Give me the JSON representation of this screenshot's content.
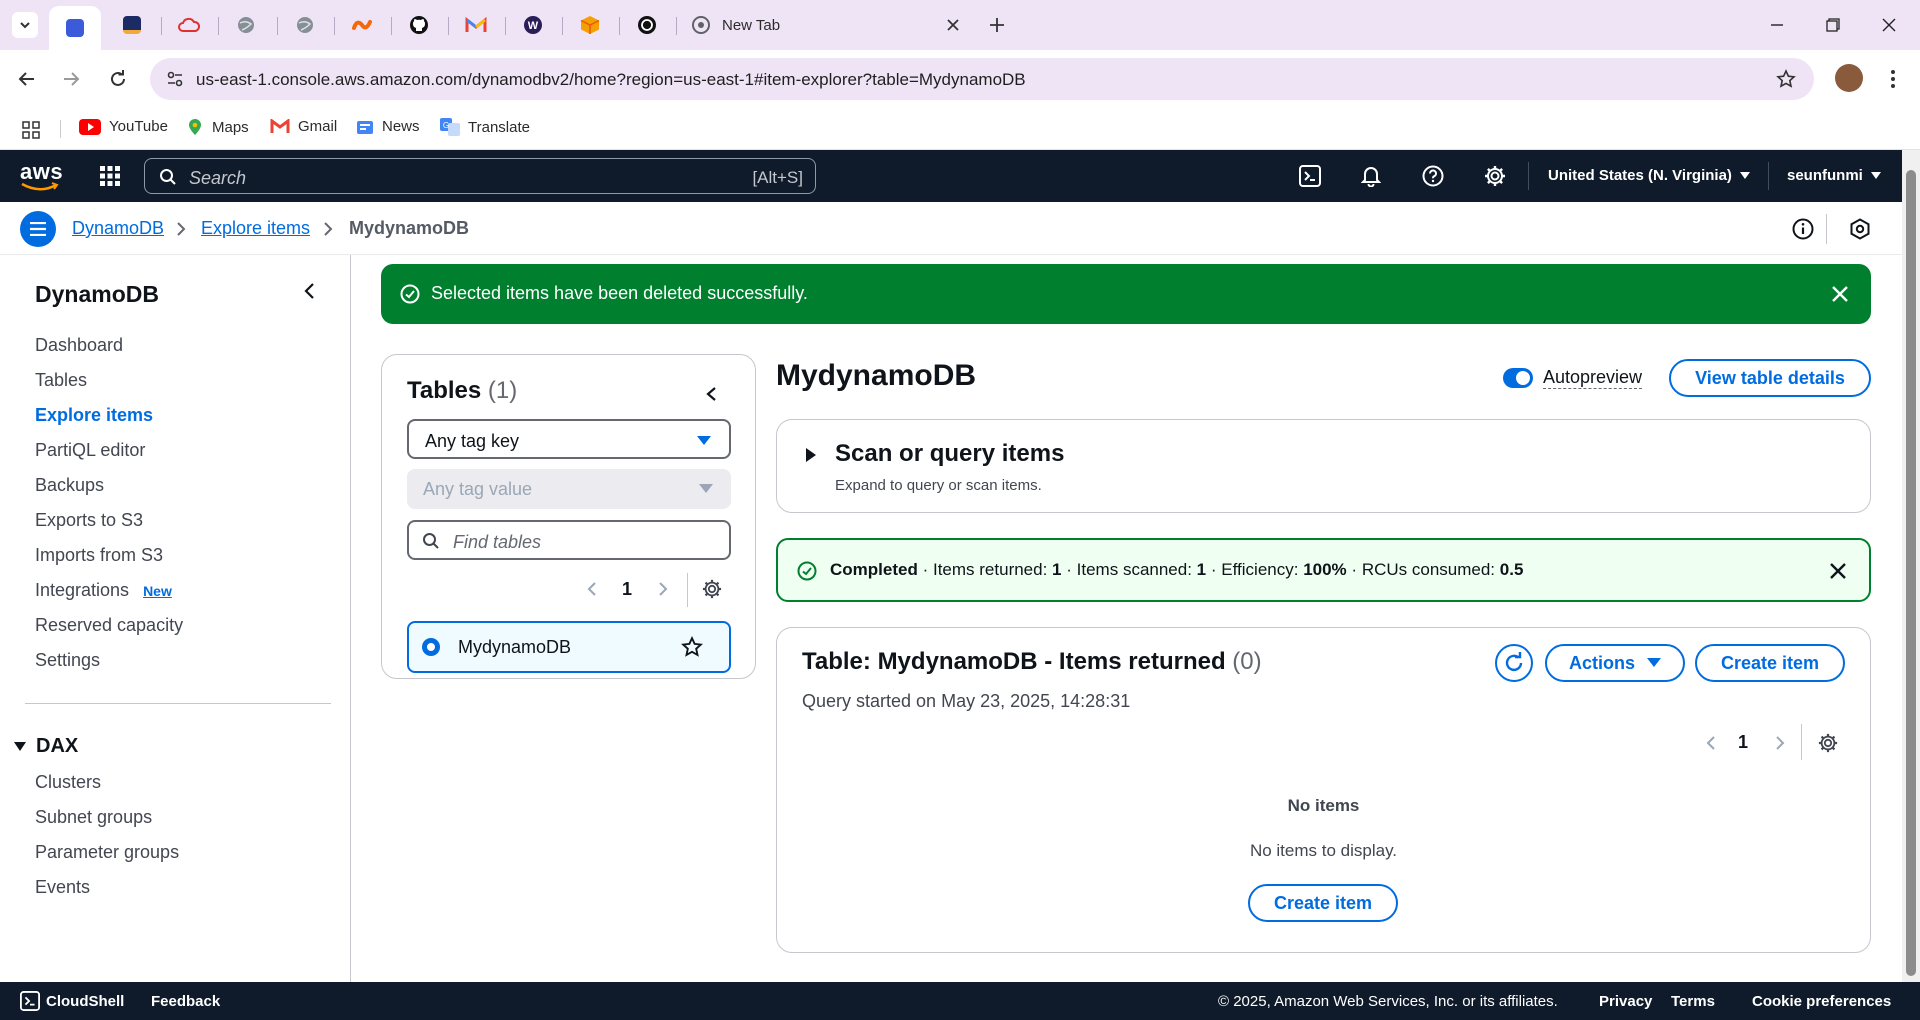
{
  "browser": {
    "tabs": [
      {
        "name": "pinned-tab-1",
        "color": "#3b5bdb"
      },
      {
        "name": "pinned-tab-2",
        "color": "#1d2b64"
      },
      {
        "name": "pinned-tab-3",
        "color": "#e03131"
      },
      {
        "name": "pinned-tab-4",
        "color": "#868e96"
      },
      {
        "name": "pinned-tab-5",
        "color": "#868e96"
      },
      {
        "name": "pinned-tab-6",
        "color": "#f76707"
      },
      {
        "name": "pinned-tab-7",
        "color": "#111111"
      },
      {
        "name": "pinned-tab-8",
        "color": "#ea4335"
      },
      {
        "name": "pinned-tab-9",
        "color": "#2b1d58"
      },
      {
        "name": "pinned-tab-10",
        "color": "#f59f00"
      },
      {
        "name": "pinned-tab-11",
        "color": "#111111"
      }
    ],
    "new_tab_title": "New Tab",
    "url": "us-east-1.console.aws.amazon.com/dynamodbv2/home?region=us-east-1#item-explorer?table=MydynamoDB",
    "bookmarks": [
      "YouTube",
      "Maps",
      "Gmail",
      "News",
      "Translate"
    ]
  },
  "aws": {
    "logo": "aws",
    "search_placeholder": "Search",
    "search_shortcut": "[Alt+S]",
    "region": "United States (N. Virginia)",
    "user": "seunfunmi",
    "accent": "#006ce0",
    "nav_bg": "#0f1b2a"
  },
  "breadcrumb": [
    "DynamoDB",
    "Explore items",
    "MydynamoDB"
  ],
  "sidebar": {
    "title": "DynamoDB",
    "items": [
      "Dashboard",
      "Tables",
      "Explore items",
      "PartiQL editor",
      "Backups",
      "Exports to S3",
      "Imports from S3",
      "Integrations",
      "Reserved capacity",
      "Settings"
    ],
    "new_badge": "New",
    "dax_title": "DAX",
    "dax_items": [
      "Clusters",
      "Subnet groups",
      "Parameter groups",
      "Events"
    ]
  },
  "flash": {
    "message": "Selected items have been deleted successfully.",
    "color": "#00802f"
  },
  "tables_panel": {
    "title": "Tables",
    "count": "(1)",
    "tag_key": "Any tag key",
    "tag_value": "Any tag value",
    "find_placeholder": "Find tables",
    "page": "1",
    "table_name": "MydynamoDB"
  },
  "detail": {
    "title": "MydynamoDB",
    "autopreview": "Autopreview",
    "view_details": "View table details",
    "scan_title": "Scan or query items",
    "scan_subtitle": "Expand to query or scan items."
  },
  "status": {
    "completed": "Completed",
    "items_returned_label": "Items returned:",
    "items_returned": "1",
    "items_scanned_label": "Items scanned:",
    "items_scanned": "1",
    "efficiency_label": "Efficiency:",
    "efficiency": "100%",
    "rcu_label": "RCUs consumed:",
    "rcu": "0.5",
    "sep": "·"
  },
  "results": {
    "title": "Table: MydynamoDB - Items returned",
    "count": "(0)",
    "actions": "Actions",
    "create_item": "Create item",
    "query_started": "Query started on May 23, 2025, 14:28:31",
    "page": "1",
    "empty_heading": "No items",
    "empty_text": "No items to display.",
    "empty_create": "Create item"
  },
  "footer": {
    "cloudshell": "CloudShell",
    "feedback": "Feedback",
    "copyright": "© 2025, Amazon Web Services, Inc. or its affiliates.",
    "privacy": "Privacy",
    "terms": "Terms",
    "cookies": "Cookie preferences"
  }
}
